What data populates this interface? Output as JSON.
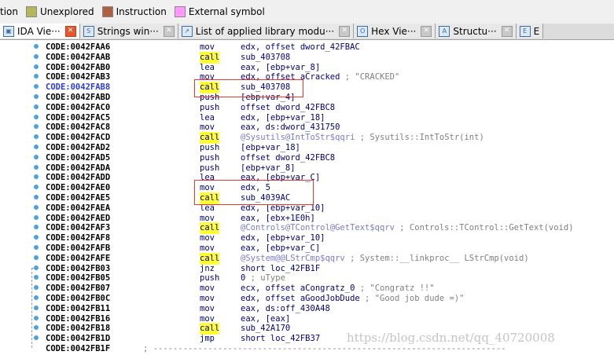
{
  "legend": [
    {
      "label": "tion",
      "color": null
    },
    {
      "label": "Unexplored",
      "color": "#b5b85a"
    },
    {
      "label": "Instruction",
      "color": "#b06040"
    },
    {
      "label": "External symbol",
      "color": "#ff99ff"
    }
  ],
  "tabs": [
    {
      "label": "IDA Vie···",
      "icon": "ida-view-icon",
      "active": true
    },
    {
      "label": "Strings win···",
      "icon": "strings-icon",
      "active": false
    },
    {
      "label": "List of applied library modu···",
      "icon": "library-icon",
      "active": false
    },
    {
      "label": "Hex Vie···",
      "icon": "hex-view-icon",
      "active": false
    },
    {
      "label": "Structu···",
      "icon": "structures-icon",
      "active": false
    },
    {
      "label": "E",
      "icon": "enums-icon",
      "active": false
    }
  ],
  "code": [
    {
      "addr": "CODE:0042FAA6",
      "mn": "mov",
      "op": "edx, offset dword_42FBAC"
    },
    {
      "addr": "CODE:0042FAAB",
      "mn": "call",
      "op": "sub_403708"
    },
    {
      "addr": "CODE:0042FAB0",
      "mn": "lea",
      "op": "eax, [ebp+var_8]"
    },
    {
      "addr": "CODE:0042FAB3",
      "mn": "mov",
      "op": "edx, offset aCracked",
      "cmt": " ; \"CRACKED\""
    },
    {
      "addr": "CODE:0042FAB8",
      "mn": "call",
      "op": "sub_403708",
      "blue": true
    },
    {
      "addr": "CODE:0042FABD",
      "mn": "push",
      "op": "[ebp+var_4]"
    },
    {
      "addr": "CODE:0042FAC0",
      "mn": "push",
      "op": "offset dword_42FBC8"
    },
    {
      "addr": "CODE:0042FAC5",
      "mn": "lea",
      "op": "edx, [ebp+var_18]"
    },
    {
      "addr": "CODE:0042FAC8",
      "mn": "mov",
      "op": "eax, ds:dword_431750"
    },
    {
      "addr": "CODE:0042FACD",
      "mn": "call",
      "op": "@Sysutils@IntToStr$qqri",
      "cmt": " ; Sysutils::IntToStr(int)",
      "lbl": true
    },
    {
      "addr": "CODE:0042FAD2",
      "mn": "push",
      "op": "[ebp+var_18]"
    },
    {
      "addr": "CODE:0042FAD5",
      "mn": "push",
      "op": "offset dword_42FBC8"
    },
    {
      "addr": "CODE:0042FADA",
      "mn": "push",
      "op": "[ebp+var_8]"
    },
    {
      "addr": "CODE:0042FADD",
      "mn": "lea",
      "op": "eax, [ebp+var_C]"
    },
    {
      "addr": "CODE:0042FAE0",
      "mn": "mov",
      "op": "edx, 5"
    },
    {
      "addr": "CODE:0042FAE5",
      "mn": "call",
      "op": "sub_4039AC"
    },
    {
      "addr": "CODE:0042FAEA",
      "mn": "lea",
      "op": "edx, [ebp+var_10]"
    },
    {
      "addr": "CODE:0042FAED",
      "mn": "mov",
      "op": "eax, [ebx+1E0h]"
    },
    {
      "addr": "CODE:0042FAF3",
      "mn": "call",
      "op": "@Controls@TControl@GetText$qqrv",
      "cmt": " ; Controls::TControl::GetText(void)",
      "lbl": true
    },
    {
      "addr": "CODE:0042FAF8",
      "mn": "mov",
      "op": "edx, [ebp+var_10]"
    },
    {
      "addr": "CODE:0042FAFB",
      "mn": "mov",
      "op": "eax, [ebp+var_C]"
    },
    {
      "addr": "CODE:0042FAFE",
      "mn": "call",
      "op": "@System@@LStrCmp$qqrv",
      "cmt": " ; System::__linkproc__ LStrCmp(void)",
      "lbl": true
    },
    {
      "addr": "CODE:0042FB03",
      "mn": "jnz",
      "op": "short loc_42FB1F"
    },
    {
      "addr": "CODE:0042FB05",
      "mn": "push",
      "op": "0",
      "cmt": "               ; uType"
    },
    {
      "addr": "CODE:0042FB07",
      "mn": "mov",
      "op": "ecx, offset aCongratz_0",
      "cmt": " ; \"Congratz !!\""
    },
    {
      "addr": "CODE:0042FB0C",
      "mn": "mov",
      "op": "edx, offset aGoodJobDude",
      "cmt": " ; \"Good job dude =)\""
    },
    {
      "addr": "CODE:0042FB11",
      "mn": "mov",
      "op": "eax, ds:off_430A48"
    },
    {
      "addr": "CODE:0042FB16",
      "mn": "mov",
      "op": "eax, [eax]"
    },
    {
      "addr": "CODE:0042FB18",
      "mn": "call",
      "op": "sub_42A170"
    },
    {
      "addr": "CODE:0042FB1D",
      "mn": "jmp",
      "op": "short loc_42FB37"
    },
    {
      "addr": "CODE:0042FB1F",
      "mn": "",
      "op": "; -----------------------------------------------------------------------"
    }
  ],
  "watermark": "https://blog.csdn.net/qq_40720008",
  "colors": {
    "call_highlight": "#ffff33",
    "mnemonic": "#00007f",
    "label": "#7a7ad0",
    "comment": "#7f7f7f",
    "annotation_box": "#e8362a",
    "active_tab_close": "#e8572c"
  }
}
